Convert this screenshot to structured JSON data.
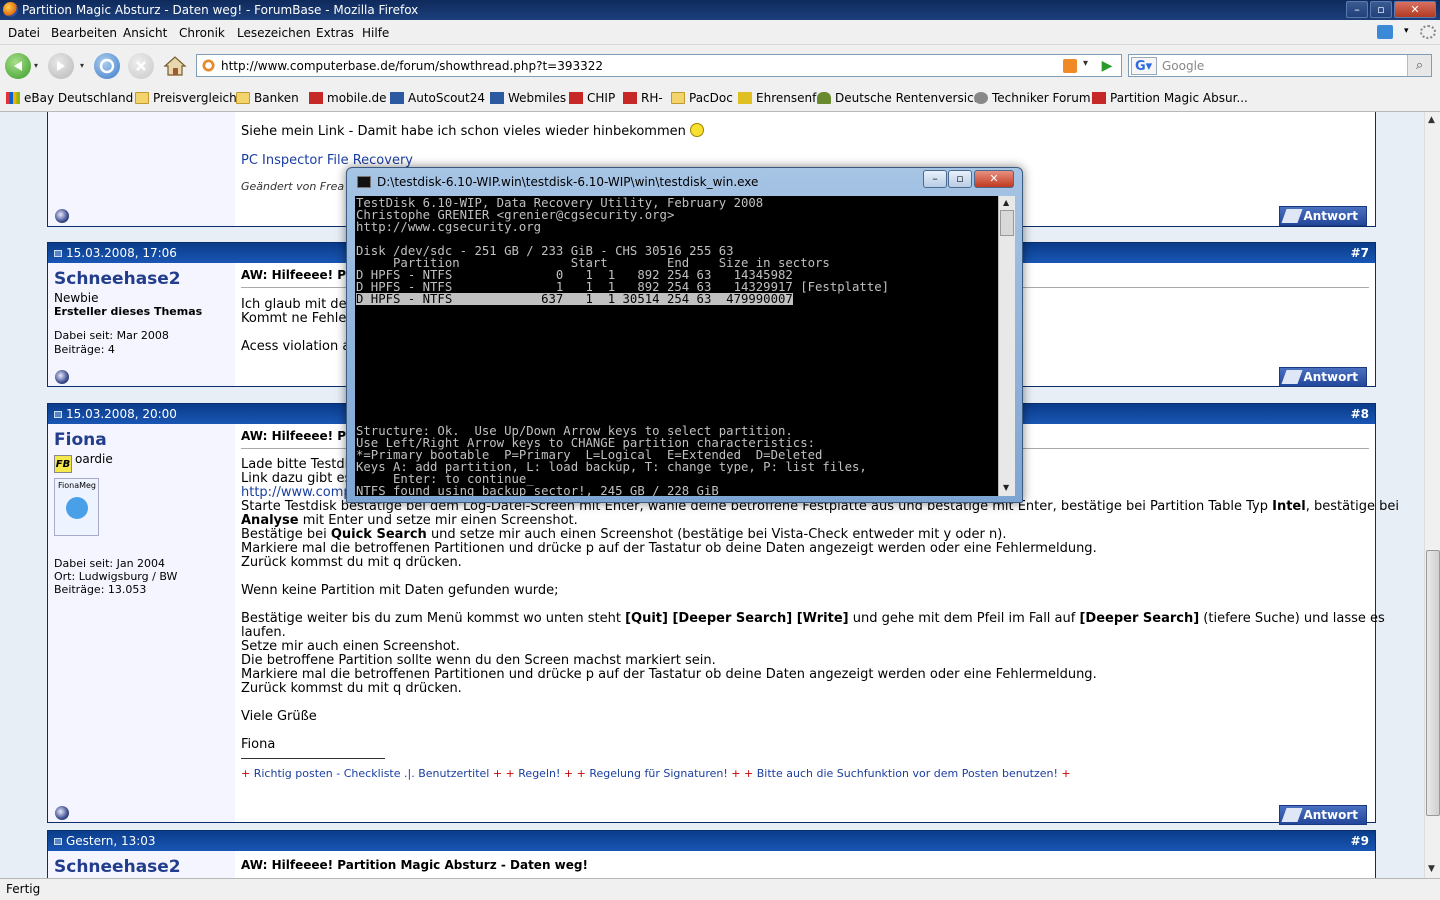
{
  "window": {
    "title": "Partition Magic Absturz - Daten weg! - ForumBase - Mozilla Firefox",
    "controls": [
      "–",
      "▫",
      "✕"
    ]
  },
  "menu": [
    "Datei",
    "Bearbeiten",
    "Ansicht",
    "Chronik",
    "Lesezeichen",
    "Extras",
    "Hilfe"
  ],
  "nav": {
    "url": "http://www.computerbase.de/forum/showthread.php?t=393322",
    "search_placeholder": "Google"
  },
  "bookmarks": [
    {
      "label": "eBay Deutschland",
      "icon": "ebay-icon"
    },
    {
      "label": "Preisvergleich",
      "icon": "folder-icon"
    },
    {
      "label": "Banken",
      "icon": "folder-icon"
    },
    {
      "label": "mobile.de",
      "icon": "mobile-icon"
    },
    {
      "label": "AutoScout24",
      "icon": "autoscout-icon"
    },
    {
      "label": "Webmiles",
      "icon": "webmiles-icon"
    },
    {
      "label": "CHIP",
      "icon": "chip-icon"
    },
    {
      "label": "RH-",
      "icon": "rh-icon"
    },
    {
      "label": "PacDoc",
      "icon": "folder-icon"
    },
    {
      "label": "Ehrensenf",
      "icon": "ehrensenf-icon"
    },
    {
      "label": "Deutsche Rentenversic...",
      "icon": "rente-icon"
    },
    {
      "label": "Techniker Forum",
      "icon": "gear-icon"
    },
    {
      "label": "Partition Magic Absur...",
      "icon": "forum-icon"
    }
  ],
  "top_post": {
    "text1": "Siehe mein Link - Damit habe ich schon vieles wieder hinbekommen",
    "link": "PC Inspector File Recovery",
    "edited": "Geändert von Frea",
    "reply": "Antwort"
  },
  "post7": {
    "date": "15.03.2008, 17:06",
    "num": "#7",
    "user": "Schneehase2",
    "rank": "Newbie",
    "role": "Ersteller dieses Themas",
    "since": "Dabei seit: Mar 2008",
    "posts": "Beiträge: 4",
    "title": "AW: Hilfeeee! Pa",
    "line1": "Ich glaub mit der",
    "line2": "Kommt ne Fehler",
    "line3": "Acess violation a",
    "reply": "Antwort"
  },
  "post8": {
    "date": "15.03.2008, 20:00",
    "num": "#8",
    "user": "Fiona",
    "rank": "oardie",
    "avatar_label": "FionaMeg",
    "since": "Dabei seit: Jan 2004",
    "place": "Ort: Ludwigsburg / BW",
    "posts": "Beiträge: 13.053",
    "title": "AW: Hilfeeee! Pa",
    "l1": "Lade bitte Testdi",
    "l2": "Link dazu gibt es",
    "l3": "http://www.comp",
    "l4a": "Starte Testdisk bestätige bei dem Log-Datei-Screen mit Enter, wähle deine betroffene Festplatte aus und bestätige mit Enter, bestätige bei Partition Table Typ ",
    "l4b": "Intel",
    "l4c": ", bestätige bei",
    "l5a": "Analyse",
    "l5b": " mit Enter und setze mir einen Screenshot.",
    "l6a": "Bestätige bei ",
    "l6b": "Quick Search",
    "l6c": " und setze mir auch einen Screenshot (bestätige bei Vista-Check entweder mit y oder n).",
    "l7": "Markiere mal die betroffenen Partitionen und drücke p auf der Tastatur ob deine Daten angezeigt werden oder eine Fehlermeldung.",
    "l8": "Zurück kommst du mit q drücken.",
    "l9": "Wenn keine Partition mit Daten gefunden wurde;",
    "l10a": "Bestätige weiter bis du zum Menü kommst wo unten steht ",
    "l10b": "[Quit] [Deeper Search] [Write]",
    "l10c": " und gehe mit dem Pfeil im Fall auf ",
    "l10d": "[Deeper Search]",
    "l10e": " (tiefere Suche) und lasse es",
    "l11": "laufen.",
    "l12": "Setze mir auch einen Screenshot.",
    "l13": "Die betroffene Partition sollte wenn du den Screen machst markiert sein.",
    "l14": "Markiere mal die betroffenen Partitionen und drücke p auf der Tastatur ob deine Daten angezeigt werden oder eine Fehlermeldung.",
    "l15": "Zurück kommst du mit q drücken.",
    "l16": "Viele Grüße",
    "l17": "Fiona",
    "sig": [
      "Richtig posten - Checkliste .|. Benutzertitel",
      "Regeln!",
      "Regelung für Signaturen!",
      "Bitte auch die Suchfunktion vor dem Posten benutzen!"
    ],
    "reply": "Antwort"
  },
  "post9": {
    "date": "Gestern, 13:03",
    "num": "#9",
    "user": "Schneehase2",
    "title": "AW: Hilfeeee! Partition Magic Absturz - Daten weg!"
  },
  "dos": {
    "title": "D:\\testdisk-6.10-WIP.win\\testdisk-6.10-WIP\\win\\testdisk_win.exe",
    "lines": [
      "TestDisk 6.10-WIP, Data Recovery Utility, February 2008",
      "Christophe GRENIER <grenier@cgsecurity.org>",
      "http://www.cgsecurity.org",
      "",
      "Disk /dev/sdc - 251 GB / 233 GiB - CHS 30516 255 63",
      "     Partition               Start        End    Size in sectors",
      "D HPFS - NTFS              0   1  1   892 254 63   14345982",
      "D HPFS - NTFS              1   1  1   892 254 63   14329917 [Festplatte]",
      "D HPFS - NTFS            637   1  1 30514 254 63  479990007"
    ],
    "footer": [
      "Structure: Ok.  Use Up/Down Arrow keys to select partition.",
      "Use Left/Right Arrow keys to CHANGE partition characteristics:",
      "*=Primary bootable  P=Primary  L=Logical  E=Extended  D=Deleted",
      "Keys A: add partition, L: load backup, T: change type, P: list files,",
      "     Enter: to continue_",
      "NTFS found using backup sector!, 245 GB / 228 GiB"
    ]
  },
  "status": "Fertig"
}
